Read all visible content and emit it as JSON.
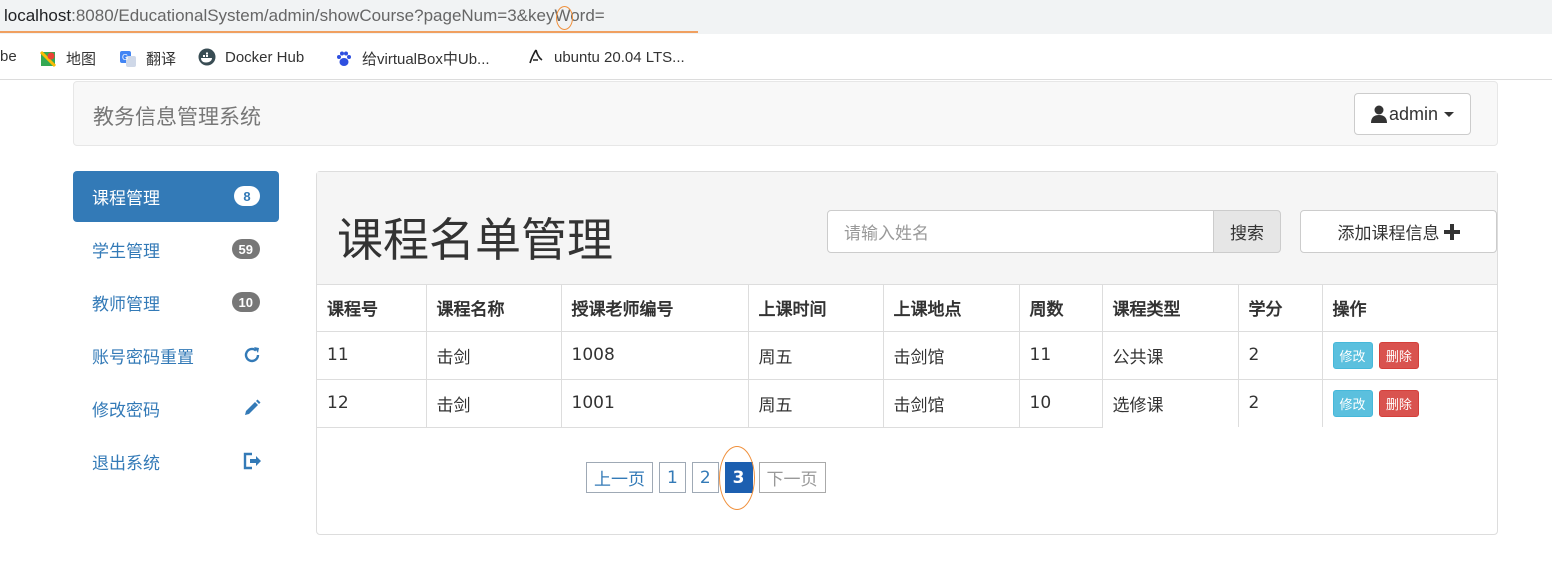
{
  "browser": {
    "url_host": "localhost",
    "url_path": ":8080/EducationalSystem/admin/showCourse?pageNum=3&keyWord=",
    "bookmarks": [
      {
        "label": "be",
        "icon": "none"
      },
      {
        "label": "地图",
        "icon": "maps-icon"
      },
      {
        "label": "翻译",
        "icon": "translate-icon"
      },
      {
        "label": "Docker Hub",
        "icon": "docker-icon"
      },
      {
        "label": "给virtualBox中Ub...",
        "icon": "baidu-paw-icon"
      },
      {
        "label": "ubuntu 20.04 LTS...",
        "icon": "ubuntu-icon"
      }
    ]
  },
  "navbar": {
    "brand": "教务信息管理系统",
    "user_label": "admin"
  },
  "sidebar": {
    "items": [
      {
        "label": "课程管理",
        "badge": "8",
        "active": true
      },
      {
        "label": "学生管理",
        "badge": "59"
      },
      {
        "label": "教师管理",
        "badge": "10"
      },
      {
        "label": "账号密码重置",
        "icon": "refresh-icon"
      },
      {
        "label": "修改密码",
        "icon": "pencil-icon"
      },
      {
        "label": "退出系统",
        "icon": "logout-icon"
      }
    ]
  },
  "main": {
    "title": "课程名单管理",
    "search_placeholder": "请输入姓名",
    "search_button": "搜索",
    "add_button": "添加课程信息",
    "table": {
      "headers": [
        "课程号",
        "课程名称",
        "授课老师编号",
        "上课时间",
        "上课地点",
        "周数",
        "课程类型",
        "学分",
        "操作"
      ],
      "rows": [
        [
          "11",
          "击剑",
          "1008",
          "周五",
          "击剑馆",
          "11",
          "公共课",
          "2"
        ],
        [
          "12",
          "击剑",
          "1001",
          "周五",
          "击剑馆",
          "10",
          "选修课",
          "2"
        ]
      ],
      "edit_label": "修改",
      "delete_label": "删除"
    },
    "pagination": {
      "prev": "上一页",
      "pages": [
        "1",
        "2",
        "3"
      ],
      "current": "3",
      "next": "下一页"
    }
  }
}
